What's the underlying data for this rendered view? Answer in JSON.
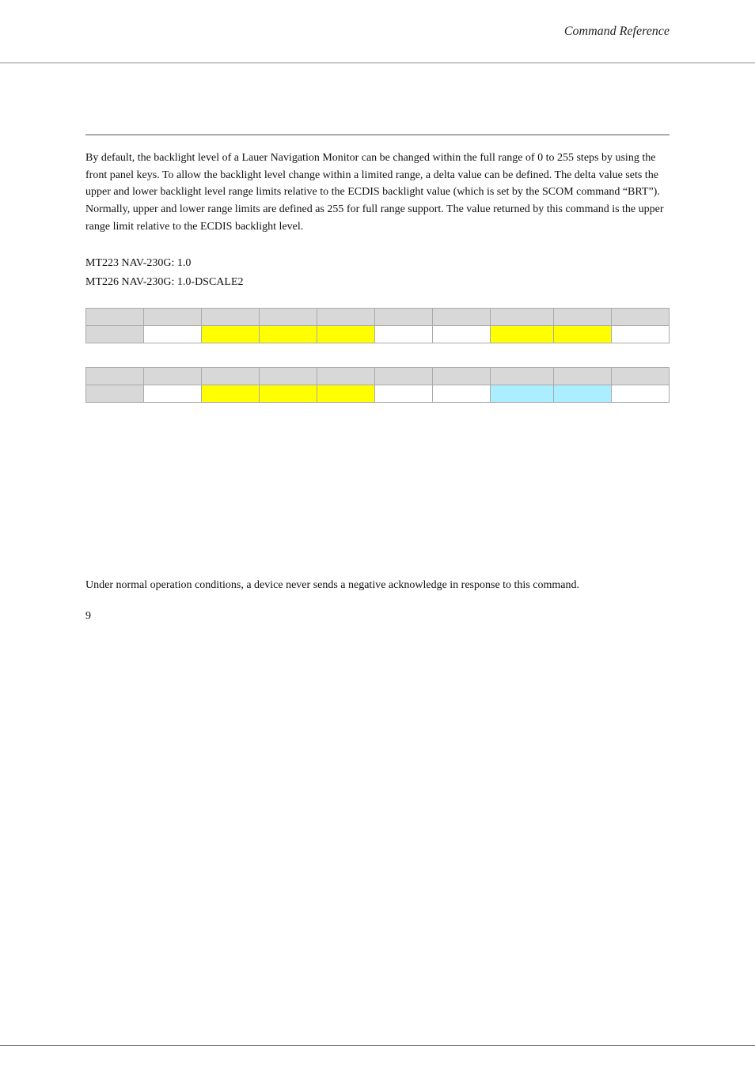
{
  "header": {
    "title": "Command Reference"
  },
  "content": {
    "description": "By default, the backlight level of a Lauer Navigation Monitor can be changed within the full range of 0 to 255 steps by using the front panel keys. To allow the backlight level change within a limited range, a delta value can be defined. The delta value sets the upper and lower backlight level range limits relative to the ECDIS backlight value (which is set by the SCOM command “BRT”). Normally, upper and lower range limits are defined as 255 for full range support. The value returned by this command is the upper range limit relative to the ECDIS backlight level.",
    "version_lines": [
      "MT223 NAV-230G: 1.0",
      "MT226 NAV-230G: 1.0-DSCALE2"
    ],
    "table1": {
      "rows": [
        [
          "gray",
          "gray",
          "gray",
          "gray",
          "gray",
          "gray",
          "gray",
          "gray",
          "gray",
          "gray",
          "gray"
        ],
        [
          "gray",
          "white",
          "yellow",
          "yellow",
          "yellow",
          "white",
          "white",
          "yellow",
          "yellow",
          "white",
          "white"
        ]
      ]
    },
    "table2": {
      "rows": [
        [
          "gray",
          "gray",
          "gray",
          "gray",
          "gray",
          "gray",
          "gray",
          "gray",
          "gray",
          "gray",
          "gray"
        ],
        [
          "gray",
          "white",
          "yellow",
          "yellow",
          "yellow",
          "white",
          "white",
          "cyan",
          "cyan",
          "white",
          "white"
        ]
      ]
    },
    "lower_text": "Under normal operation conditions, a device never sends a negative acknowledge in response to this command.",
    "page_number": "9"
  },
  "footer": {}
}
